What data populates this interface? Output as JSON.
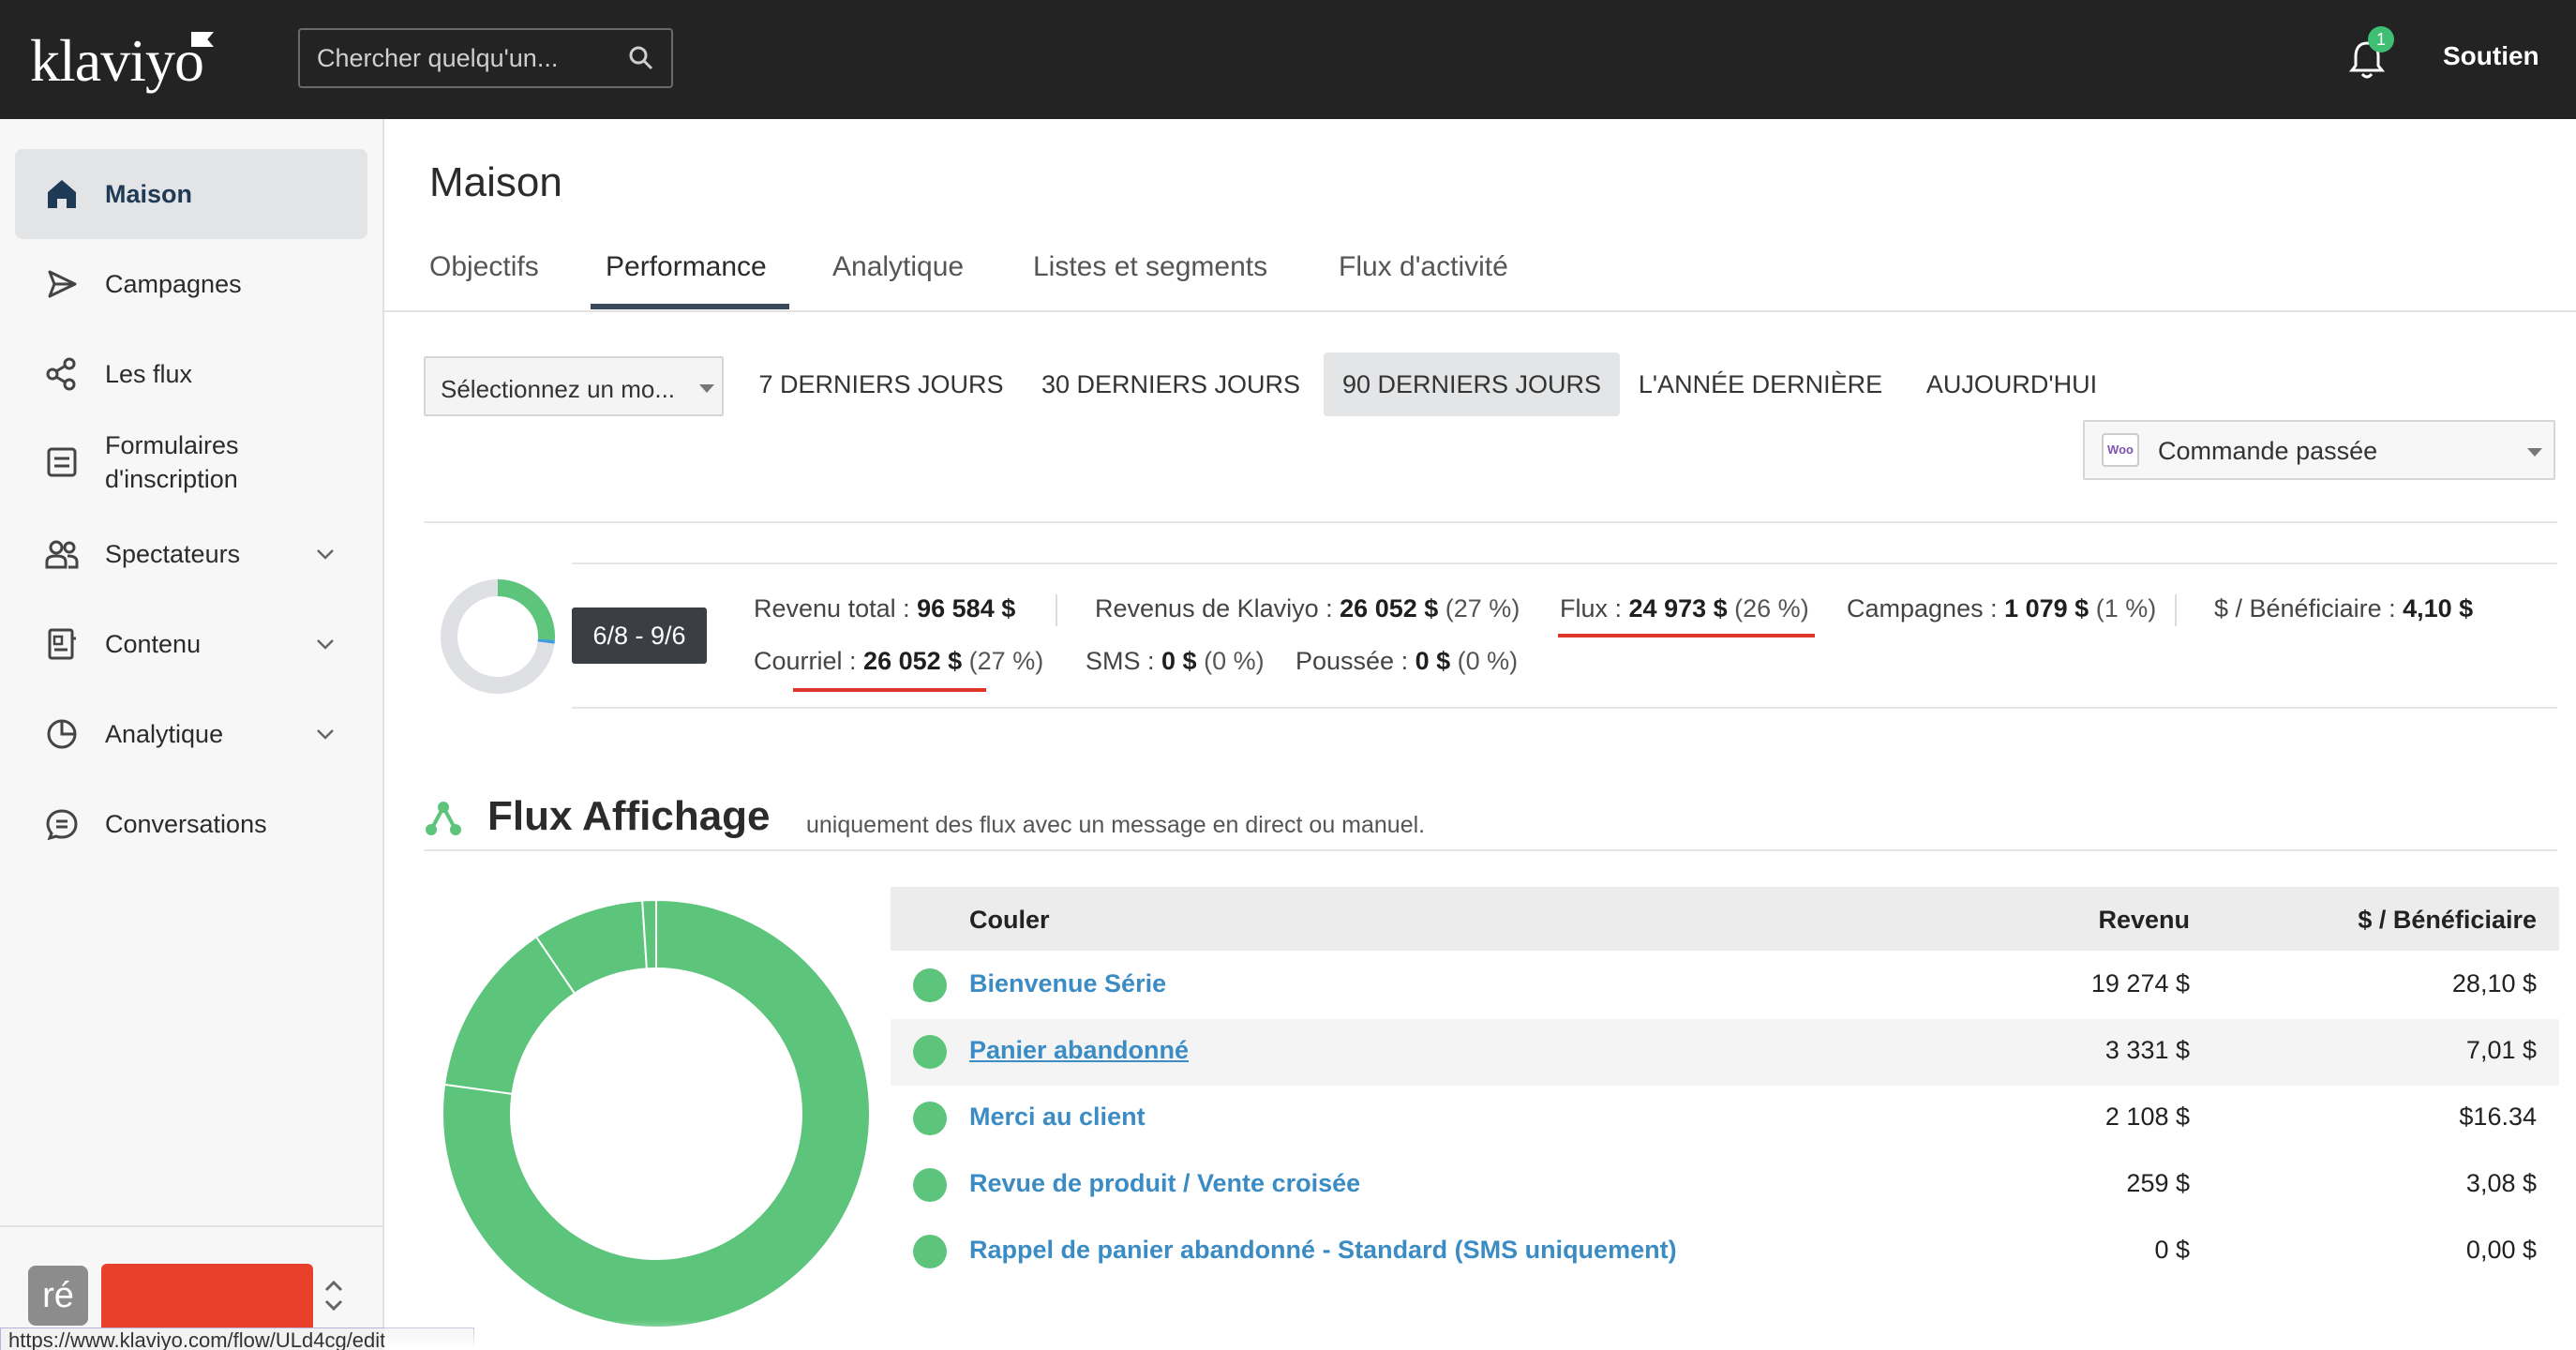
{
  "header": {
    "logo": "klaviyo",
    "search_placeholder": "Chercher quelqu'un...",
    "notification_count": "1",
    "support_label": "Soutien"
  },
  "sidebar": {
    "items": [
      {
        "label": "Maison",
        "icon": "home-icon",
        "active": true
      },
      {
        "label": "Campagnes",
        "icon": "send-icon"
      },
      {
        "label": "Les flux",
        "icon": "flows-icon"
      },
      {
        "label": "Formulaires d'inscription",
        "line1": "Formulaires",
        "line2": "d'inscription",
        "icon": "form-icon"
      },
      {
        "label": "Spectateurs",
        "icon": "audience-icon",
        "expandable": true
      },
      {
        "label": "Contenu",
        "icon": "content-icon",
        "expandable": true
      },
      {
        "label": "Analytique",
        "icon": "analytics-icon",
        "expandable": true
      },
      {
        "label": "Conversations",
        "icon": "chat-icon"
      }
    ],
    "account_initials": "ré"
  },
  "status_url": "https://www.klaviyo.com/flow/ULd4cg/edit",
  "page": {
    "title": "Maison",
    "tabs": [
      "Objectifs",
      "Performance",
      "Analytique",
      "Listes et segments",
      "Flux d'activité"
    ],
    "active_tab": "Performance"
  },
  "filters": {
    "select_placeholder": "Sélectionnez un mo...",
    "ranges": [
      "7 DERNIERS JOURS",
      "30 DERNIERS JOURS",
      "90 DERNIERS JOURS",
      "L'ANNÉE DERNIÈRE",
      "AUJOURD'HUI"
    ],
    "active_range": "90 DERNIERS JOURS",
    "metric": "Commande passée",
    "metric_icon_text": "Woo"
  },
  "summary": {
    "date_range": "6/8 - 9/6",
    "total_revenue_label": "Revenu total :",
    "total_revenue": "96 584 $",
    "klaviyo_revenue_label": "Revenus de Klaviyo :",
    "klaviyo_revenue": "26 052 $",
    "klaviyo_revenue_pct": "(27 %)",
    "flows_label": "Flux :",
    "flows_revenue": "24 973 $",
    "flows_pct": "(26 %)",
    "campaigns_label": "Campagnes :",
    "campaigns_revenue": "1 079 $",
    "campaigns_pct": "(1 %)",
    "per_recipient_label": "$ / Bénéficiaire :",
    "per_recipient": "4,10 $",
    "email_label": "Courriel :",
    "email_revenue": "26 052 $",
    "email_pct": "(27 %)",
    "sms_label": "SMS :",
    "sms_revenue": "0 $",
    "sms_pct": "(0 %)",
    "push_label": "Poussée :",
    "push_revenue": "0 $",
    "push_pct": "(0 %)",
    "share_flows_pct": 26,
    "share_campaigns_pct": 1
  },
  "flows_section": {
    "title": "Flux Affichage",
    "subtitle": "uniquement des flux avec un message en direct ou manuel.",
    "columns": [
      "Couler",
      "Revenu",
      "$ / Bénéficiaire"
    ],
    "rows": [
      {
        "name": "Bienvenue Série",
        "revenue": "19 274 $",
        "per_recipient": "28,10 $"
      },
      {
        "name": "Panier abandonné",
        "revenue": "3 331 $",
        "per_recipient": "7,01 $"
      },
      {
        "name": "Merci au client",
        "revenue": "2 108 $",
        "per_recipient": "$16.34"
      },
      {
        "name": "Revue de produit / Vente croisée",
        "revenue": "259 $",
        "per_recipient": "3,08 $"
      },
      {
        "name": "Rappel de panier abandonné - Standard (SMS uniquement)",
        "revenue": "0 $",
        "per_recipient": "0,00 $"
      }
    ],
    "donut_values": [
      19274,
      3331,
      2108,
      259,
      0
    ],
    "color": "#5cc57b"
  }
}
